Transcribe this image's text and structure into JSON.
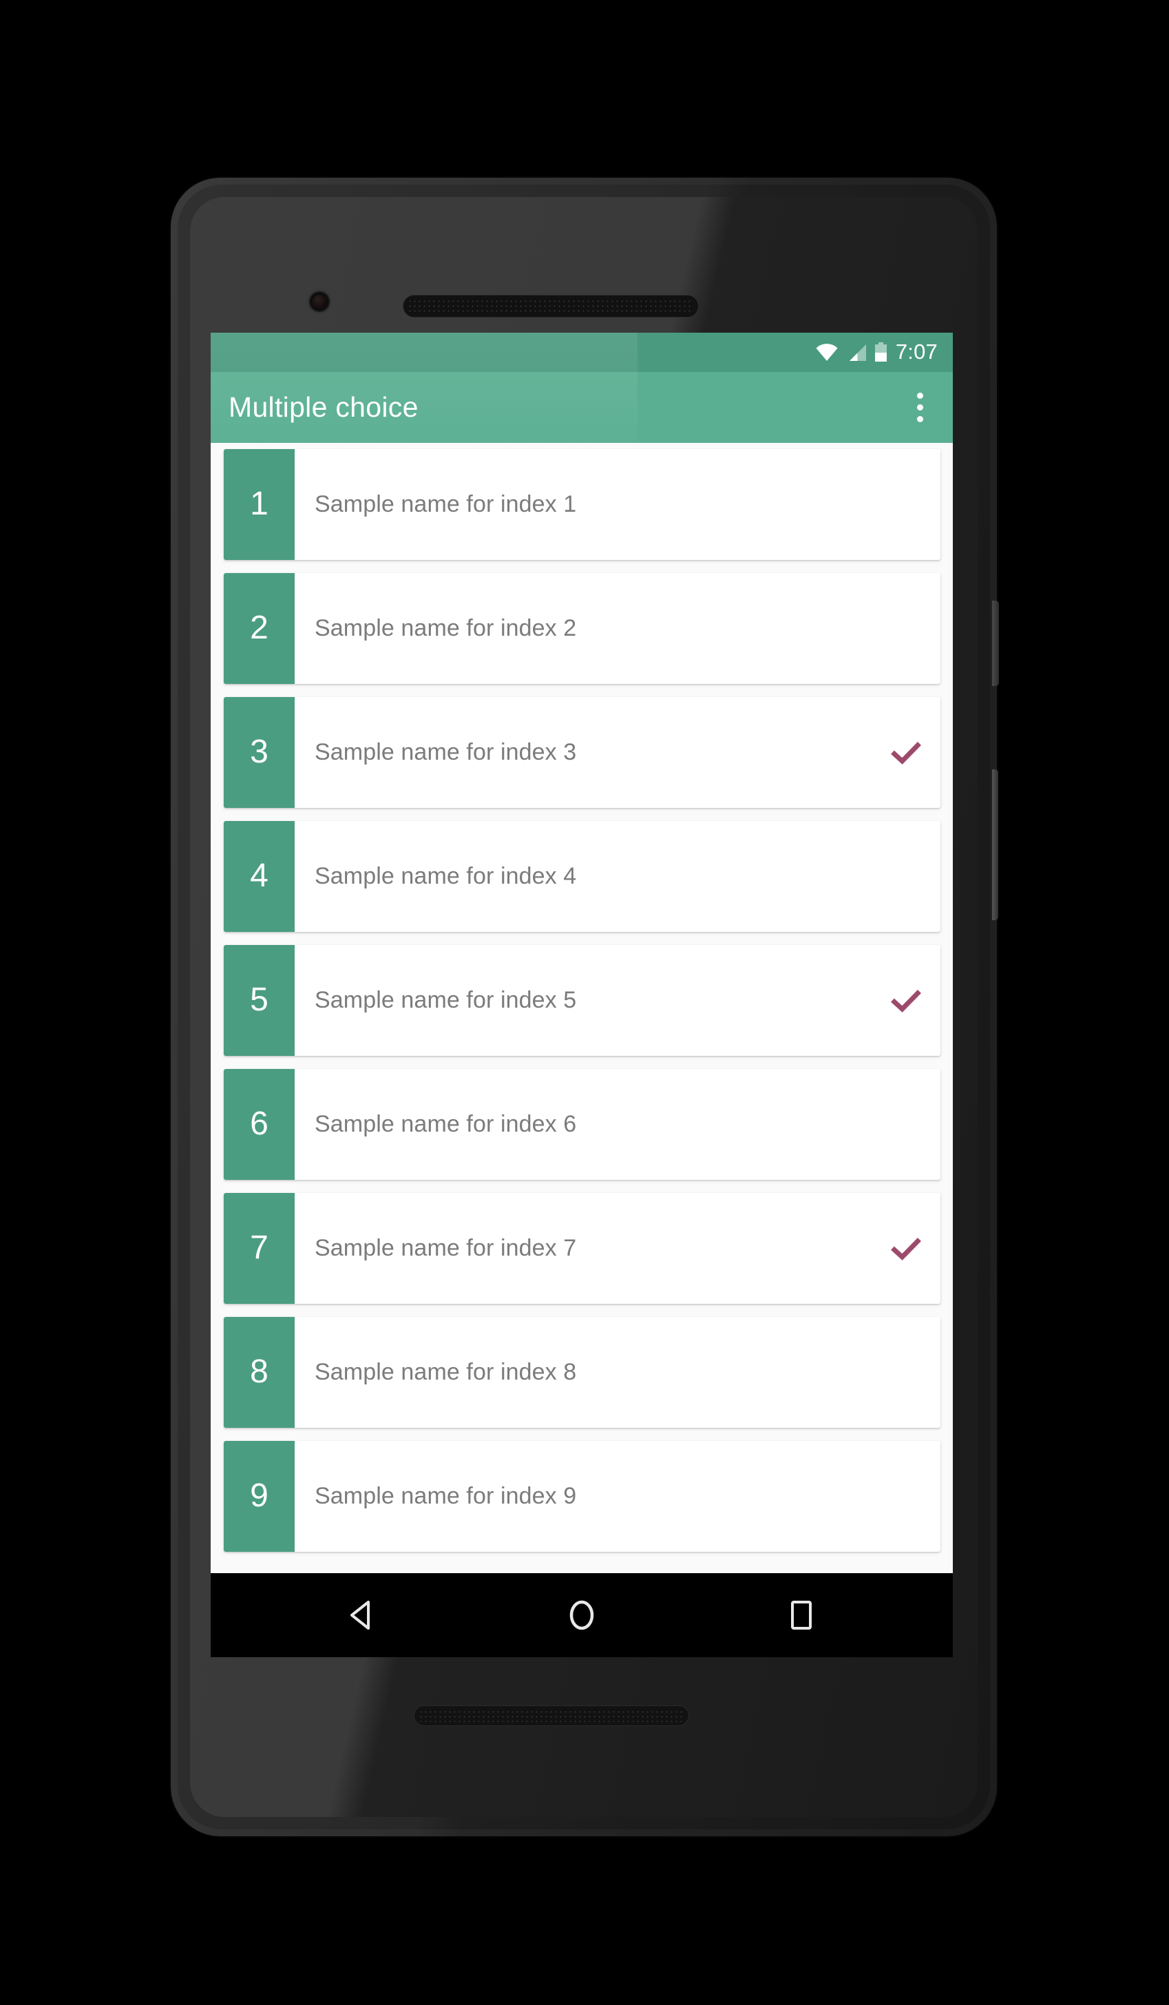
{
  "device": {
    "name": "android-phone",
    "bezel_color": "#2b2b2b"
  },
  "statusbar": {
    "background": "#4a9a80",
    "time": "7:07",
    "icons": [
      "wifi-icon",
      "signal-icon",
      "battery-icon"
    ]
  },
  "appbar": {
    "background": "#5aaf92",
    "title": "Multiple choice",
    "overflow_label": "More options"
  },
  "list": {
    "background": "#fafafa",
    "badge_color": "#4a9d80",
    "check_color": "#9c4a6c",
    "label_color": "#7b7b7b",
    "items": [
      {
        "number": "1",
        "label": "Sample name for index 1",
        "checked": false
      },
      {
        "number": "2",
        "label": "Sample name for index 2",
        "checked": false
      },
      {
        "number": "3",
        "label": "Sample name for index 3",
        "checked": true
      },
      {
        "number": "4",
        "label": "Sample name for index 4",
        "checked": false
      },
      {
        "number": "5",
        "label": "Sample name for index 5",
        "checked": true
      },
      {
        "number": "6",
        "label": "Sample name for index 6",
        "checked": false
      },
      {
        "number": "7",
        "label": "Sample name for index 7",
        "checked": true
      },
      {
        "number": "8",
        "label": "Sample name for index 8",
        "checked": false
      },
      {
        "number": "9",
        "label": "Sample name for index 9",
        "checked": false
      }
    ]
  },
  "navbar": {
    "background": "#000000",
    "buttons": [
      {
        "name": "back-icon",
        "label": "Back"
      },
      {
        "name": "home-icon",
        "label": "Home"
      },
      {
        "name": "recents-icon",
        "label": "Recents"
      }
    ]
  }
}
